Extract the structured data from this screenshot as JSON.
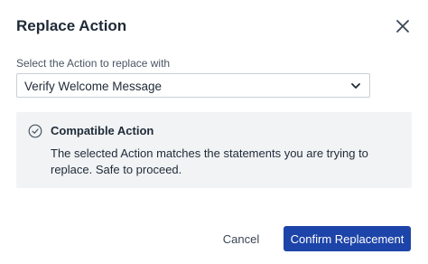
{
  "dialog": {
    "title": "Replace Action",
    "close_icon": "close-icon"
  },
  "select": {
    "label": "Select the Action to replace with",
    "value": "Verify Welcome Message",
    "icon": "chevron-down-icon"
  },
  "notice": {
    "icon": "check-circle-icon",
    "title": "Compatible Action",
    "text": "The selected Action matches the statements you are trying to replace. Safe to proceed."
  },
  "footer": {
    "cancel_label": "Cancel",
    "confirm_label": "Confirm Replacement"
  },
  "colors": {
    "primary": "#1d44a8",
    "notice_background": "#f1f3f5",
    "text": "#1f2a37"
  }
}
